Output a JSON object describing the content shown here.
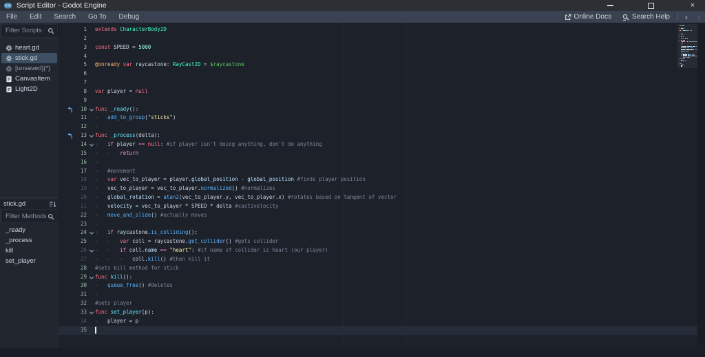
{
  "window": {
    "title": "Script Editor - Godot Engine",
    "controls": {
      "minimize": "minimize",
      "maximize": "maximize",
      "close": "×"
    }
  },
  "menubar": {
    "items": [
      "File",
      "Edit",
      "Search",
      "Go To",
      "Debug"
    ],
    "online_docs_label": "Online Docs",
    "search_help_label": "Search Help",
    "nav_back": "‹",
    "nav_forward": "›"
  },
  "sidebar": {
    "filter_scripts_placeholder": "Filter Scripts",
    "scripts": [
      {
        "label": "heart.gd",
        "icon": "script-icon",
        "selected": false,
        "dim": false
      },
      {
        "label": "stick.gd",
        "icon": "script-icon",
        "selected": true,
        "dim": false
      },
      {
        "label": "[unsaved](*)",
        "icon": "script-unsaved-icon",
        "selected": false,
        "dim": true
      },
      {
        "label": "CanvasItem",
        "icon": "class-doc-icon",
        "selected": false,
        "dim": false
      },
      {
        "label": "Light2D",
        "icon": "class-doc-icon",
        "selected": false,
        "dim": false
      }
    ],
    "current_script": "stick.gd",
    "filter_methods_placeholder": "Filter Methods",
    "methods": [
      "_ready",
      "_process",
      "kill",
      "set_player"
    ]
  },
  "editor": {
    "syntax": {
      "kw": "#ff7085",
      "flow": "#ff8ccc",
      "type": "#42ffc2",
      "num": "#a1ffe0",
      "ann": "#ffb373",
      "path": "#5dcb63",
      "fn": "#66e6ff",
      "call": "#57b3ff",
      "str": "#ffeda1",
      "com": "#7f8799",
      "txt": "#ccd6e0",
      "mem": "#bce0ff"
    },
    "colors": {
      "safe_line_number": "#9dc0a4",
      "unsafe_line_number": "#505a67",
      "selection_bg": "#3d4f63",
      "current_line_bg": "#252c37",
      "editor_bg": "#1c212a"
    },
    "lines": [
      {
        "n": 1,
        "safe": true,
        "tabs": 0,
        "seg": [
          [
            "kw",
            "extends"
          ],
          [
            "txt",
            " "
          ],
          [
            "type",
            "CharacterBody2D"
          ]
        ]
      },
      {
        "n": 2,
        "safe": true,
        "tabs": 0,
        "seg": []
      },
      {
        "n": 3,
        "safe": true,
        "tabs": 0,
        "seg": [
          [
            "kw",
            "const"
          ],
          [
            "txt",
            " SPEED = "
          ],
          [
            "num",
            "5000"
          ]
        ]
      },
      {
        "n": 4,
        "safe": true,
        "tabs": 0,
        "seg": []
      },
      {
        "n": 5,
        "safe": true,
        "tabs": 0,
        "seg": [
          [
            "ann",
            "@onready"
          ],
          [
            "txt",
            " "
          ],
          [
            "kw",
            "var"
          ],
          [
            "txt",
            " raycastone: "
          ],
          [
            "type",
            "RayCast2D"
          ],
          [
            "txt",
            " = "
          ],
          [
            "path",
            "$raycastone"
          ]
        ]
      },
      {
        "n": 6,
        "safe": true,
        "tabs": 0,
        "seg": []
      },
      {
        "n": 7,
        "safe": true,
        "tabs": 0,
        "seg": []
      },
      {
        "n": 8,
        "safe": true,
        "tabs": 0,
        "seg": [
          [
            "kw",
            "var"
          ],
          [
            "txt",
            " player = "
          ],
          [
            "kw",
            "null"
          ]
        ]
      },
      {
        "n": 9,
        "safe": true,
        "tabs": 0,
        "seg": []
      },
      {
        "n": 10,
        "safe": true,
        "tabs": 0,
        "ovr": true,
        "fold": true,
        "seg": [
          [
            "kw",
            "func"
          ],
          [
            "txt",
            " "
          ],
          [
            "fn",
            "_ready"
          ],
          [
            "txt",
            "():"
          ]
        ]
      },
      {
        "n": 11,
        "safe": true,
        "tabs": 1,
        "seg": [
          [
            "call",
            "add_to_group"
          ],
          [
            "txt",
            "("
          ],
          [
            "str",
            "\"sticks\""
          ],
          [
            "txt",
            ")"
          ]
        ]
      },
      {
        "n": 12,
        "safe": true,
        "tabs": 1,
        "seg": []
      },
      {
        "n": 13,
        "safe": true,
        "tabs": 0,
        "ovr": true,
        "fold": true,
        "seg": [
          [
            "kw",
            "func"
          ],
          [
            "txt",
            " "
          ],
          [
            "fn",
            "_process"
          ],
          [
            "txt",
            "(delta):"
          ]
        ]
      },
      {
        "n": 14,
        "safe": true,
        "tabs": 1,
        "fold": true,
        "seg": [
          [
            "flow",
            "if"
          ],
          [
            "txt",
            " player "
          ],
          [
            "flow",
            "=="
          ],
          [
            "txt",
            " "
          ],
          [
            "kw",
            "null"
          ],
          [
            "txt",
            ": "
          ],
          [
            "com",
            "#if player isn't doing anything, don't do anything"
          ]
        ]
      },
      {
        "n": 15,
        "safe": true,
        "tabs": 2,
        "seg": [
          [
            "flow",
            "return"
          ]
        ]
      },
      {
        "n": 16,
        "safe": true,
        "tabs": 1,
        "seg": []
      },
      {
        "n": 17,
        "safe": true,
        "tabs": 1,
        "seg": [
          [
            "com",
            "#movement"
          ]
        ]
      },
      {
        "n": 18,
        "safe": false,
        "tabs": 1,
        "seg": [
          [
            "kw",
            "var"
          ],
          [
            "txt",
            " vec_to_player = player."
          ],
          [
            "mem",
            "global_position"
          ],
          [
            "txt",
            " - "
          ],
          [
            "mem",
            "global_position"
          ],
          [
            "txt",
            " "
          ],
          [
            "com",
            "#finds player position"
          ]
        ]
      },
      {
        "n": 19,
        "safe": false,
        "tabs": 1,
        "seg": [
          [
            "txt",
            "vec_to_player = vec_to_player."
          ],
          [
            "call",
            "normalized"
          ],
          [
            "txt",
            "() "
          ],
          [
            "com",
            "#normalizes"
          ]
        ]
      },
      {
        "n": 20,
        "safe": false,
        "tabs": 1,
        "seg": [
          [
            "mem",
            "global_rotation"
          ],
          [
            "txt",
            " = "
          ],
          [
            "call",
            "atan2"
          ],
          [
            "txt",
            "(vec_to_player.y, vec_to_player.x) "
          ],
          [
            "com",
            "#rotates based on tangent of vector"
          ]
        ]
      },
      {
        "n": 21,
        "safe": false,
        "tabs": 1,
        "seg": [
          [
            "mem",
            "velocity"
          ],
          [
            "txt",
            " = vec_to_player * SPEED * delta "
          ],
          [
            "com",
            "#castivelocity"
          ]
        ]
      },
      {
        "n": 22,
        "safe": true,
        "tabs": 1,
        "seg": [
          [
            "call",
            "move_and_slide"
          ],
          [
            "txt",
            "() "
          ],
          [
            "com",
            "#actually moves"
          ]
        ]
      },
      {
        "n": 23,
        "safe": true,
        "tabs": 1,
        "seg": []
      },
      {
        "n": 24,
        "safe": true,
        "tabs": 1,
        "fold": true,
        "seg": [
          [
            "flow",
            "if"
          ],
          [
            "txt",
            " raycastone."
          ],
          [
            "call",
            "is_colliding"
          ],
          [
            "txt",
            "():"
          ]
        ]
      },
      {
        "n": 25,
        "safe": true,
        "tabs": 2,
        "seg": [
          [
            "kw",
            "var"
          ],
          [
            "txt",
            " coll = raycastone."
          ],
          [
            "call",
            "get_collider"
          ],
          [
            "txt",
            "() "
          ],
          [
            "com",
            "#gets collider"
          ]
        ]
      },
      {
        "n": 26,
        "safe": false,
        "tabs": 2,
        "fold": true,
        "seg": [
          [
            "flow",
            "if"
          ],
          [
            "txt",
            " coll."
          ],
          [
            "mem",
            "name"
          ],
          [
            "txt",
            " "
          ],
          [
            "flow",
            "=="
          ],
          [
            "txt",
            " "
          ],
          [
            "str",
            "\"heart\""
          ],
          [
            "txt",
            ": "
          ],
          [
            "com",
            "#if name of collider is heart (our player)"
          ]
        ]
      },
      {
        "n": 27,
        "safe": false,
        "tabs": 3,
        "seg": [
          [
            "txt",
            "coll."
          ],
          [
            "call",
            "kill"
          ],
          [
            "txt",
            "() "
          ],
          [
            "com",
            "#then kill it"
          ]
        ]
      },
      {
        "n": 28,
        "safe": true,
        "tabs": 0,
        "seg": [
          [
            "com",
            "#sets kill method for stick"
          ]
        ]
      },
      {
        "n": 29,
        "safe": true,
        "tabs": 0,
        "fold": true,
        "seg": [
          [
            "kw",
            "func"
          ],
          [
            "txt",
            " "
          ],
          [
            "fn",
            "kill"
          ],
          [
            "txt",
            "():"
          ]
        ]
      },
      {
        "n": 30,
        "safe": true,
        "tabs": 1,
        "seg": [
          [
            "call",
            "queue_free"
          ],
          [
            "txt",
            "() "
          ],
          [
            "com",
            "#deletes"
          ]
        ]
      },
      {
        "n": 31,
        "safe": true,
        "tabs": 1,
        "seg": []
      },
      {
        "n": 32,
        "safe": true,
        "tabs": 0,
        "seg": [
          [
            "com",
            "#sets player"
          ]
        ]
      },
      {
        "n": 33,
        "safe": true,
        "tabs": 0,
        "fold": true,
        "seg": [
          [
            "kw",
            "func"
          ],
          [
            "txt",
            " "
          ],
          [
            "fn",
            "set_player"
          ],
          [
            "txt",
            "(p):"
          ]
        ]
      },
      {
        "n": 34,
        "safe": false,
        "tabs": 1,
        "seg": [
          [
            "txt",
            "player = p"
          ]
        ]
      },
      {
        "n": 35,
        "safe": true,
        "tabs": 0,
        "cur": true,
        "seg": []
      }
    ]
  }
}
